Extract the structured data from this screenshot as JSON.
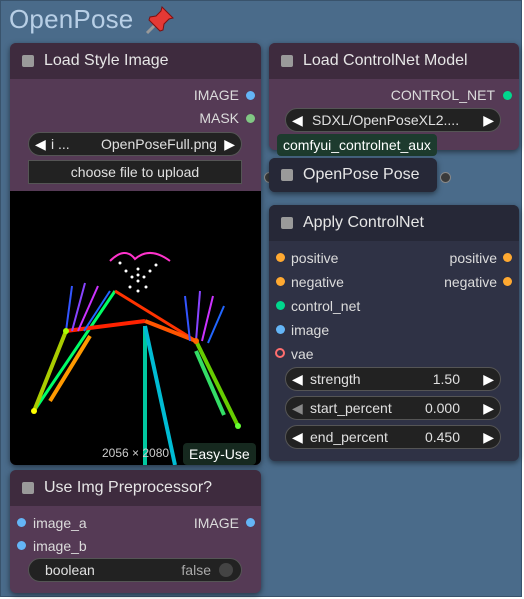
{
  "group": {
    "title": "OpenPose",
    "pin_icon": "pushpin-icon"
  },
  "load_style_image": {
    "title": "Load Style Image",
    "outputs": [
      "IMAGE",
      "MASK"
    ],
    "file_value": "OpenPoseFull.png",
    "file_prefix": "i ...",
    "upload_label": "choose file to upload",
    "image_size": "2056 × 2080",
    "badge": "Easy-Use"
  },
  "load_controlnet": {
    "title": "Load ControlNet Model",
    "output": "CONTROL_NET",
    "model_value": "SDXL/OpenPoseXL2....",
    "tooltip": "comfyui_controlnet_aux"
  },
  "openpose_pose": {
    "title": "OpenPose Pose"
  },
  "apply_controlnet": {
    "title": "Apply ControlNet",
    "inputs": [
      "positive",
      "negative",
      "control_net",
      "image",
      "vae"
    ],
    "outputs": [
      "positive",
      "negative"
    ],
    "widgets": [
      {
        "label": "strength",
        "value": "1.50"
      },
      {
        "label": "start_percent",
        "value": "0.000"
      },
      {
        "label": "end_percent",
        "value": "0.450"
      }
    ]
  },
  "use_img_preprocessor": {
    "title": "Use Img Preprocessor?",
    "inputs": [
      "image_a",
      "image_b"
    ],
    "output": "IMAGE",
    "toggle_label": "boolean",
    "toggle_value": "false"
  },
  "colors": {
    "image_socket": "#64b5f6",
    "mask_socket": "#81c784",
    "control_net_socket": "#00d78d",
    "conditioning_socket": "#ffa931",
    "vae_socket": "#ff6e6e"
  }
}
